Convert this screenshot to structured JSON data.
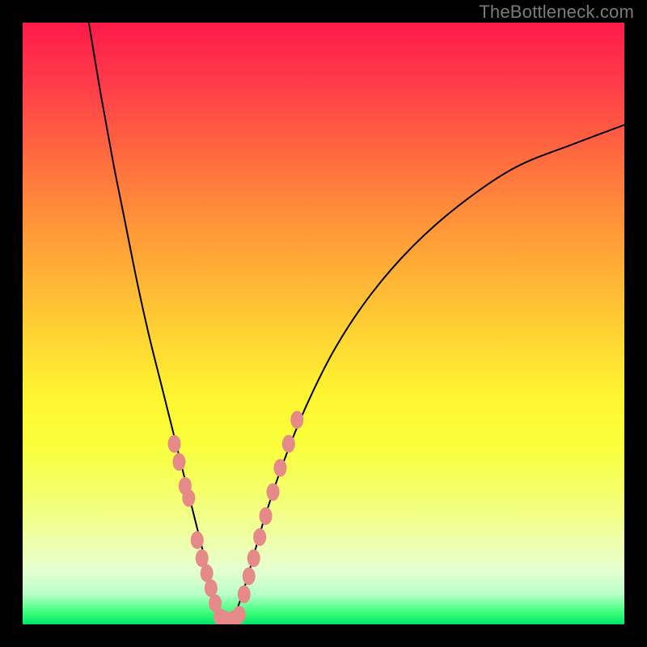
{
  "watermark": "TheBottleneck.com",
  "chart_data": {
    "type": "line",
    "title": "",
    "xlabel": "",
    "ylabel": "",
    "xlim": [
      0,
      100
    ],
    "ylim": [
      0,
      100
    ],
    "grid": false,
    "series": [
      {
        "name": "left-branch",
        "x": [
          11,
          13,
          15,
          17,
          19,
          21,
          23,
          25,
          27,
          28.5,
          30,
          31,
          32,
          33
        ],
        "y": [
          100,
          88,
          77,
          67,
          57,
          48,
          40,
          32,
          24,
          18,
          12,
          8,
          4,
          1
        ]
      },
      {
        "name": "right-branch",
        "x": [
          35,
          36.5,
          38,
          40,
          43,
          47,
          52,
          58,
          65,
          73,
          82,
          92,
          100
        ],
        "y": [
          1,
          5,
          10,
          17,
          26,
          36,
          46,
          55,
          63,
          70,
          76,
          80,
          83
        ]
      },
      {
        "name": "valley-floor",
        "x": [
          33,
          34,
          35
        ],
        "y": [
          1,
          0.5,
          1
        ]
      }
    ],
    "markers": [
      {
        "name": "left-branch-dots",
        "x": [
          25.2,
          26.0,
          27.0,
          27.6,
          29.0,
          29.8,
          30.6,
          31.3,
          32.0
        ],
        "y": [
          30,
          27,
          23,
          21,
          14,
          11,
          8.5,
          6,
          3.5
        ]
      },
      {
        "name": "valley-dots",
        "x": [
          32.8,
          33.6,
          34.4,
          35.2,
          36.0
        ],
        "y": [
          1.2,
          0.8,
          0.6,
          0.9,
          1.6
        ]
      },
      {
        "name": "right-branch-dots",
        "x": [
          36.8,
          37.6,
          38.4,
          39.4,
          40.4,
          41.6,
          42.8,
          44.2,
          45.6
        ],
        "y": [
          5,
          8,
          11,
          14.5,
          18,
          22,
          26,
          30,
          34
        ]
      }
    ],
    "marker_color": "#e58a88",
    "line_color": "#000000",
    "gradient_stops": [
      {
        "pos": 0,
        "color": "#ff1a4a"
      },
      {
        "pos": 50,
        "color": "#ffe433"
      },
      {
        "pos": 100,
        "color": "#00e56a"
      }
    ]
  }
}
